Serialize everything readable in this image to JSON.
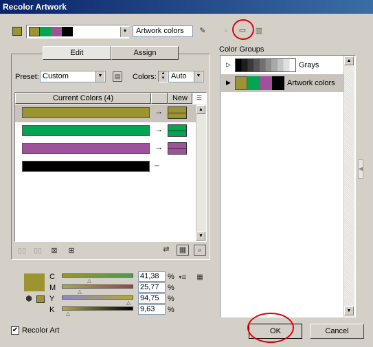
{
  "window": {
    "title": "Recolor Artwork"
  },
  "top": {
    "group_name_value": "Artwork colors",
    "color_swatches": [
      "#9b9431",
      "#00a651",
      "#a0519c",
      "#000000"
    ]
  },
  "tabs": [
    {
      "label": "Edit"
    },
    {
      "label": "Assign"
    }
  ],
  "preset": {
    "label": "Preset:",
    "value": "Custom"
  },
  "colors": {
    "label": "Colors:",
    "value": "Auto"
  },
  "table": {
    "header_current": "Current Colors (4)",
    "header_new": "New",
    "rows": [
      {
        "current": "#9b9431",
        "new": "#9b9431",
        "mapped": true,
        "selected": true
      },
      {
        "current": "#00a651",
        "new": "#00a651",
        "mapped": true,
        "selected": false
      },
      {
        "current": "#a0519c",
        "new": "#a0519c",
        "mapped": true,
        "selected": false
      },
      {
        "current": "#000000",
        "new": "",
        "mapped": false,
        "selected": false
      }
    ]
  },
  "cmyk": {
    "swatch_color": "#9b9431",
    "channels": [
      {
        "label": "C",
        "value": "41,38",
        "unit": "%"
      },
      {
        "label": "M",
        "value": "25,77",
        "unit": "%"
      },
      {
        "label": "Y",
        "value": "94,75",
        "unit": "%"
      },
      {
        "label": "K",
        "value": "9,63",
        "unit": "%"
      }
    ]
  },
  "color_groups": {
    "label": "Color Groups",
    "groups": [
      {
        "name": "Grays",
        "swatches": [
          "#000000",
          "#1e1e1e",
          "#3a3a3a",
          "#555555",
          "#707070",
          "#8c8c8c",
          "#a8a8a8",
          "#c4c4c4",
          "#e0e0e0",
          "#ffffff"
        ]
      },
      {
        "name": "Artwork colors",
        "swatches": [
          "#9b9431",
          "#00a651",
          "#a0519c",
          "#000000"
        ]
      }
    ]
  },
  "recolor_art": {
    "label": "Recolor Art",
    "checked": true
  },
  "buttons": {
    "ok": "OK",
    "cancel": "Cancel"
  }
}
